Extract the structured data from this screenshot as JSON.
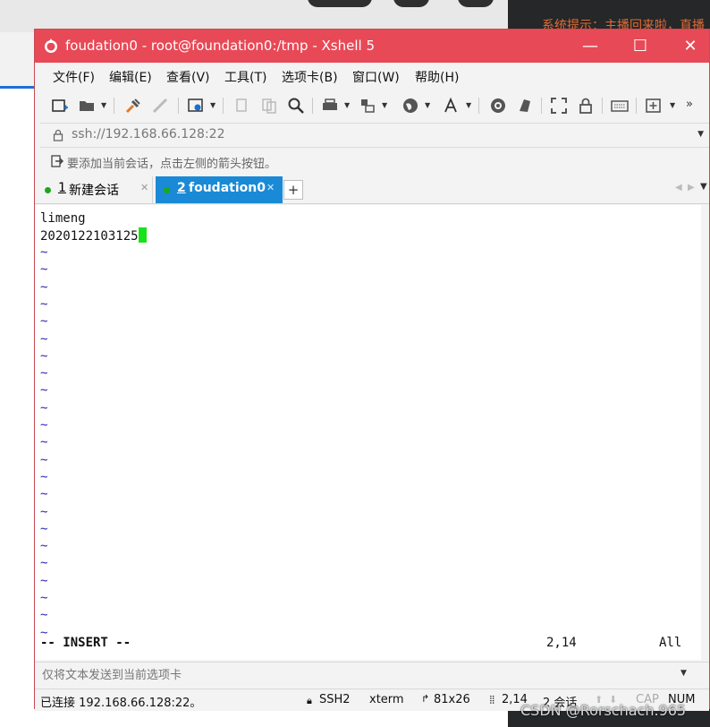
{
  "window": {
    "title": "foudation0 - root@foundation0:/tmp - Xshell 5",
    "minimize": "—",
    "maximize": "☐",
    "close": "✕"
  },
  "background": {
    "right_panel_text": "系统提示：主播回来啦，直播"
  },
  "menu": [
    {
      "label": "文件(F)"
    },
    {
      "label": "编辑(E)"
    },
    {
      "label": "查看(V)"
    },
    {
      "label": "工具(T)"
    },
    {
      "label": "选项卡(B)"
    },
    {
      "label": "窗口(W)"
    },
    {
      "label": "帮助(H)"
    }
  ],
  "address": {
    "value": "ssh://192.168.66.128:22"
  },
  "hint": {
    "text": "要添加当前会话，点击左侧的箭头按钮。"
  },
  "tabs": [
    {
      "number": "1",
      "label": "新建会话"
    },
    {
      "number": "2",
      "label": "foudation0"
    }
  ],
  "terminal": {
    "lines": [
      "limeng",
      "2020122103125"
    ],
    "tilde_char": "~",
    "mode": "-- INSERT --",
    "position": "2,14",
    "scroll": "All"
  },
  "sendbar": {
    "placeholder": "仅将文本发送到当前选项卡"
  },
  "statusbar": {
    "connection": "已连接 192.168.66.128:22。",
    "protocol": "SSH2",
    "terminal_type": "xterm",
    "size": "81x26",
    "cursor": "2,14",
    "sessions": "2 会话",
    "cap": "CAP",
    "num": "NUM"
  },
  "watermark": "CSDN @Rorschach.965",
  "colors": {
    "titlebar": "#e84956",
    "active_tab": "#1a8ad6",
    "cursor": "#18e318",
    "tilde": "#2a2ab0"
  }
}
